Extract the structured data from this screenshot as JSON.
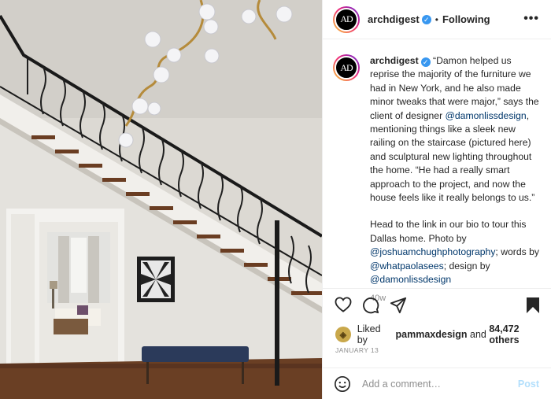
{
  "post": {
    "image_alt": "Staircase with wrought iron railing and sculptural chandelier in a Dallas home"
  },
  "header": {
    "username": "archdigest",
    "verified_badge": "verified-badge-icon",
    "separator": "•",
    "follow_label": "Following",
    "more_label": "•••",
    "avatar_initials": "AD"
  },
  "caption": {
    "username": "archdigest",
    "paragraph1": [
      {
        "text": "“Damon helped us reprise the majority of the furniture we had in New York, and he also made minor tweaks that were major,” says the client of designer "
      },
      {
        "mention": "@damonlissdesign"
      },
      {
        "text": ", mentioning things like a sleek new railing on the staircase (pictured here) and sculptural new lighting throughout the home. “He had a really smart approach to the project, and now the house feels like it really belongs to us.”"
      }
    ],
    "paragraph2_intro": "Head to the link in our bio to tour this Dallas home. Photo by ",
    "photographer": "@joshuamchughphotography",
    "words_label": "; words by ",
    "writer": "@whatpaolasees",
    "design_label": "; design by ",
    "designer": "@damonlissdesign",
    "age": "40w"
  },
  "actions": {
    "like_icon": "heart-icon",
    "comment_icon": "comment-icon",
    "share_icon": "share-icon",
    "save_icon": "bookmark-icon"
  },
  "likes": {
    "prefix": "Liked by ",
    "liker": "pammaxdesign",
    "middle": " and ",
    "count": "84,472 others"
  },
  "date": "January 13",
  "comment": {
    "placeholder": "Add a comment…",
    "post_label": "Post",
    "emoji_icon": "emoji-icon"
  },
  "colors": {
    "link": "#00376b",
    "post_button": "#b2dffc",
    "verified": "#3897f0",
    "muted": "#8e8e8e"
  }
}
